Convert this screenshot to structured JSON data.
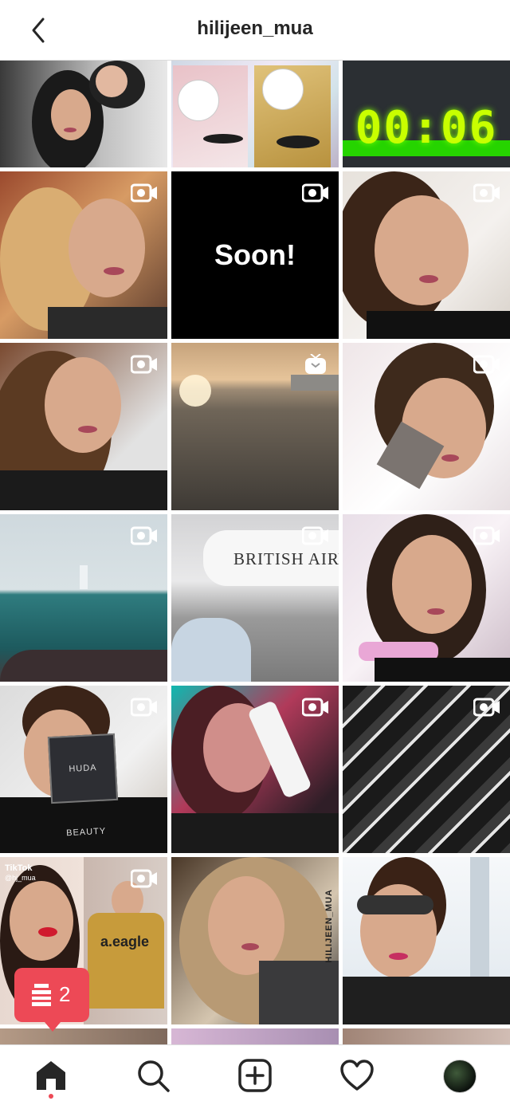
{
  "header": {
    "title": "hilijeen_mua",
    "back_icon": "chevron-left-icon"
  },
  "grid": {
    "posts": [
      {
        "type": "photo"
      },
      {
        "type": "photo"
      },
      {
        "type": "photo",
        "overlay_text": "00:06"
      },
      {
        "type": "igtv"
      },
      {
        "type": "igtv",
        "overlay_text": "Soon!"
      },
      {
        "type": "igtv"
      },
      {
        "type": "igtv"
      },
      {
        "type": "igtv-logo"
      },
      {
        "type": "igtv"
      },
      {
        "type": "igtv"
      },
      {
        "type": "igtv",
        "overlay_text": "BRITISH AIRV"
      },
      {
        "type": "igtv"
      },
      {
        "type": "igtv",
        "overlay_text": "HUDA BEAUTY"
      },
      {
        "type": "igtv"
      },
      {
        "type": "igtv"
      },
      {
        "type": "igtv",
        "overlay_text": "TikTok",
        "sub_text": "@hj_mua",
        "shirt_text": "a.eagle"
      },
      {
        "type": "photo",
        "overlay_text": "HILIJEEN_MUA"
      },
      {
        "type": "photo"
      }
    ]
  },
  "notification": {
    "count": "2",
    "icon": "activity-feed-icon",
    "color": "#ed4956"
  },
  "bottom_nav": {
    "items": [
      "home-icon",
      "search-icon",
      "new-post-icon",
      "heart-icon",
      "profile-avatar"
    ]
  },
  "colors": {
    "accent": "#ed4956",
    "divider": "#dbdbdb",
    "text": "#262626"
  }
}
